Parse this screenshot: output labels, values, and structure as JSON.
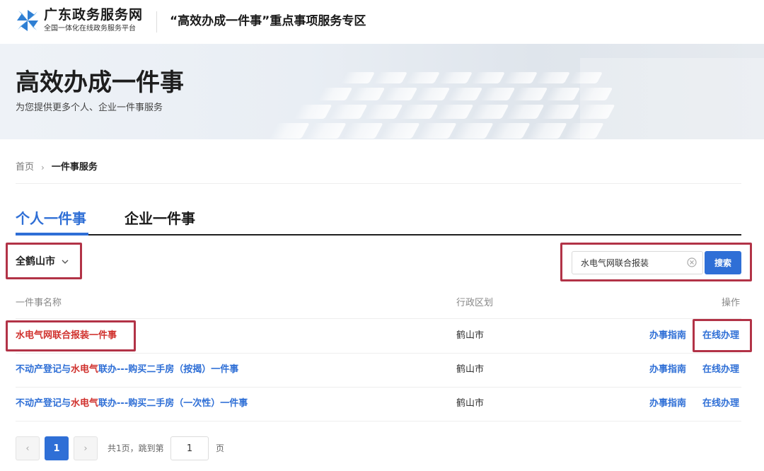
{
  "header": {
    "brand_name": "广东政务服务网",
    "brand_sub": "全国一体化在线政务服务平台",
    "title": "“高效办成一件事”重点事项服务专区",
    "logo_icon": "pinwheel-logo-icon"
  },
  "banner": {
    "title": "高效办成一件事",
    "subtitle": "为您提供更多个人、企业一件事服务"
  },
  "breadcrumb": {
    "home": "首页",
    "separator": "›",
    "current": "一件事服务"
  },
  "tabs": [
    {
      "label": "个人一件事",
      "active": true
    },
    {
      "label": "企业一件事",
      "active": false
    }
  ],
  "filter": {
    "region": "全鹤山市",
    "icon": "chevron-down-icon"
  },
  "search": {
    "value": "水电气网联合报装",
    "button_label": "搜索",
    "clear_icon": "clear-circle-icon"
  },
  "table": {
    "headers": {
      "name": "一件事名称",
      "region": "行政区划",
      "action": "操作"
    },
    "rows": [
      {
        "name_pre": "",
        "name_kw": "水电气网联合报装一件事",
        "name_post": "",
        "region": "鹤山市",
        "guide": "办事指南",
        "online": "在线办理"
      },
      {
        "name_pre": "不动产登记与",
        "name_kw": "水电气",
        "name_post": "联办---购买二手房（按揭）一件事",
        "region": "鹤山市",
        "guide": "办事指南",
        "online": "在线办理"
      },
      {
        "name_pre": "不动产登记与",
        "name_kw": "水电气",
        "name_post": "联办---购买二手房（一次性）一件事",
        "region": "鹤山市",
        "guide": "办事指南",
        "online": "在线办理"
      }
    ]
  },
  "pagination": {
    "prev": "‹",
    "current_page": "1",
    "next": "›",
    "info": "共1页，跳到第",
    "jump_value": "1",
    "unit": "页"
  },
  "colors": {
    "accent": "#2f6fd6",
    "highlight_keyword": "#d0312d",
    "annotation_box": "#b23347"
  }
}
